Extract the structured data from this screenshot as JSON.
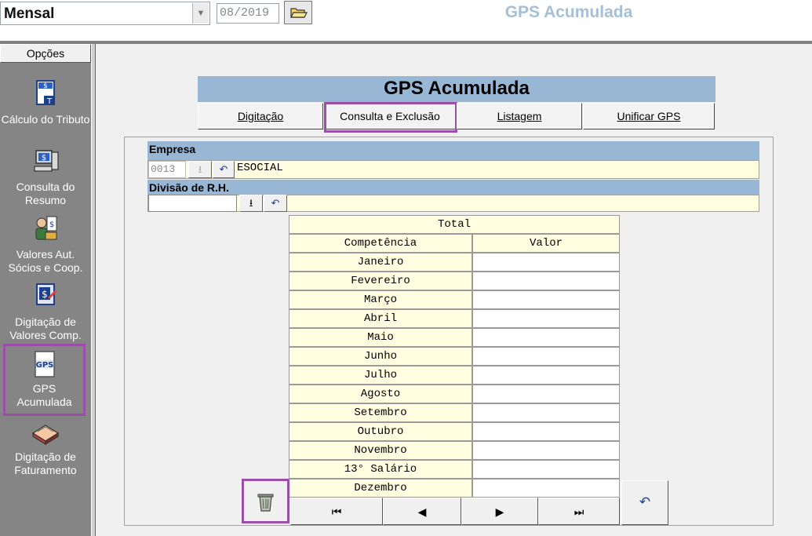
{
  "topbar": {
    "period": "Mensal",
    "competencia": "08/2019",
    "title": "GPS Acumulada",
    "folder_icon": "folder-open-icon"
  },
  "sidebar": {
    "header": "Opções",
    "items": [
      {
        "label": "Cálculo do Tributo",
        "icon": "tax-calculation-icon"
      },
      {
        "label": "Consulta do Resumo",
        "icon": "computer-summary-icon"
      },
      {
        "label": "Valores Aut. Sócios e  Coop.",
        "icon": "partners-money-icon"
      },
      {
        "label": "Digitação de Valores Comp.",
        "icon": "money-entry-icon"
      },
      {
        "label": "GPS Acumulada",
        "icon": "gps-document-icon",
        "selected": true
      },
      {
        "label": "Digitação de Faturamento",
        "icon": "invoice-book-icon"
      }
    ]
  },
  "main": {
    "title": "GPS Acumulada",
    "tabs": [
      "Digitação",
      "Consulta e Exclusão",
      "Listagem",
      "Unificar GPS"
    ],
    "active_tab": "Consulta e Exclusão",
    "empresa": {
      "label": "Empresa",
      "code": "0013",
      "name": "ESOCIAL"
    },
    "divisao": {
      "label": "Divisão de R.H.",
      "code": "",
      "name": ""
    },
    "table": {
      "title": "Total",
      "columns": [
        "Competência",
        "Valor"
      ],
      "rows": [
        {
          "mes": "Janeiro",
          "valor": ""
        },
        {
          "mes": "Fevereiro",
          "valor": ""
        },
        {
          "mes": "Março",
          "valor": ""
        },
        {
          "mes": "Abril",
          "valor": ""
        },
        {
          "mes": "Maio",
          "valor": ""
        },
        {
          "mes": "Junho",
          "valor": ""
        },
        {
          "mes": "Julho",
          "valor": ""
        },
        {
          "mes": "Agosto",
          "valor": ""
        },
        {
          "mes": "Setembro",
          "valor": ""
        },
        {
          "mes": "Outubro",
          "valor": ""
        },
        {
          "mes": "Novembro",
          "valor": ""
        },
        {
          "mes": "13° Salário",
          "valor": ""
        },
        {
          "mes": "Dezembro",
          "valor": ""
        }
      ]
    },
    "nav_icons": [
      "first-record-icon",
      "previous-record-icon",
      "next-record-icon",
      "last-record-icon"
    ],
    "highlight_color": "#9a4fa6",
    "header_color": "#98b7d5",
    "field_color": "#fffee0"
  }
}
